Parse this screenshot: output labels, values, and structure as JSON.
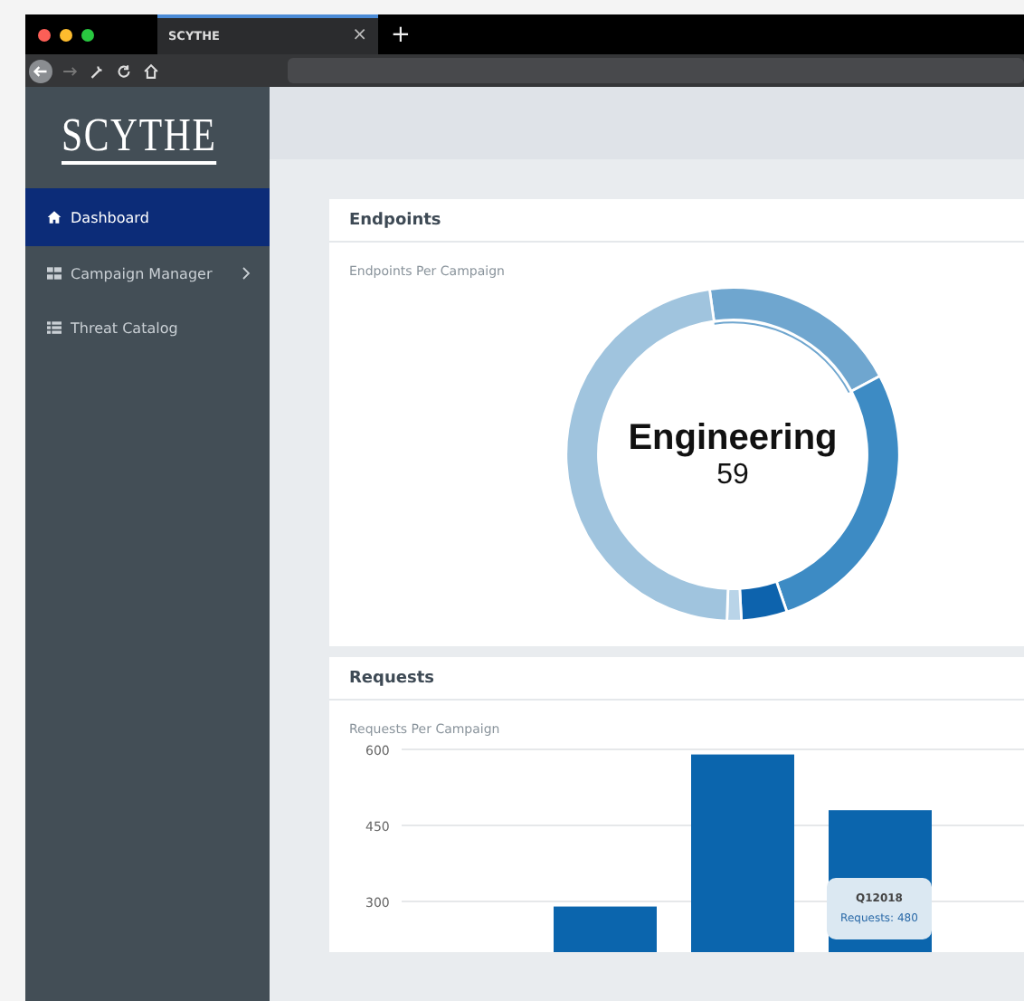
{
  "browser": {
    "tab_title": "SCYTHE",
    "close_label": "×",
    "new_tab_label": "+"
  },
  "sidebar": {
    "logo": "SCYTHE",
    "items": [
      {
        "label": "Dashboard",
        "kind": "home",
        "selected": true,
        "has_submenu": false
      },
      {
        "label": "Campaign Manager",
        "kind": "grid",
        "selected": false,
        "has_submenu": true
      },
      {
        "label": "Threat Catalog",
        "kind": "list",
        "selected": false,
        "has_submenu": false
      }
    ]
  },
  "endpoints": {
    "title": "Endpoints",
    "subtitle": "Endpoints Per Campaign",
    "center_label": "Engineering",
    "center_value": "59"
  },
  "requests": {
    "title": "Requests",
    "subtitle": "Requests Per Campaign",
    "chart_data": {
      "type": "bar",
      "ylim": [
        200,
        600
      ],
      "grid": true,
      "yticks": [
        300,
        450,
        600
      ],
      "values": [
        290,
        590,
        480
      ]
    },
    "tooltip": {
      "title": "Q12018",
      "text": "Requests: 480"
    }
  }
}
